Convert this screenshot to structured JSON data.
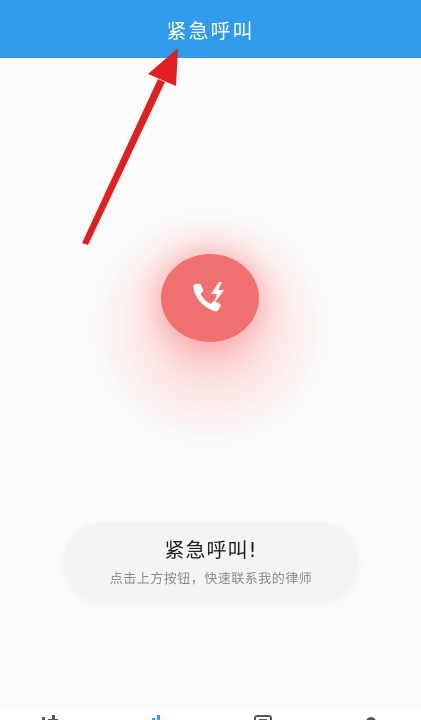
{
  "header": {
    "title": "紧急呼叫"
  },
  "call_button": {
    "icon": "phone-lightning-icon"
  },
  "info_card": {
    "title": "紧急呼叫!",
    "subtitle": "点击上方按钮，快速联系我的律师"
  },
  "tabbar": {
    "icons": [
      "home-icon",
      "stats-icon",
      "calendar-icon",
      "profile-icon"
    ]
  },
  "colors": {
    "header": "#2f9bea",
    "call_button": "#f0706f",
    "annotation_arrow": "#e02020"
  }
}
